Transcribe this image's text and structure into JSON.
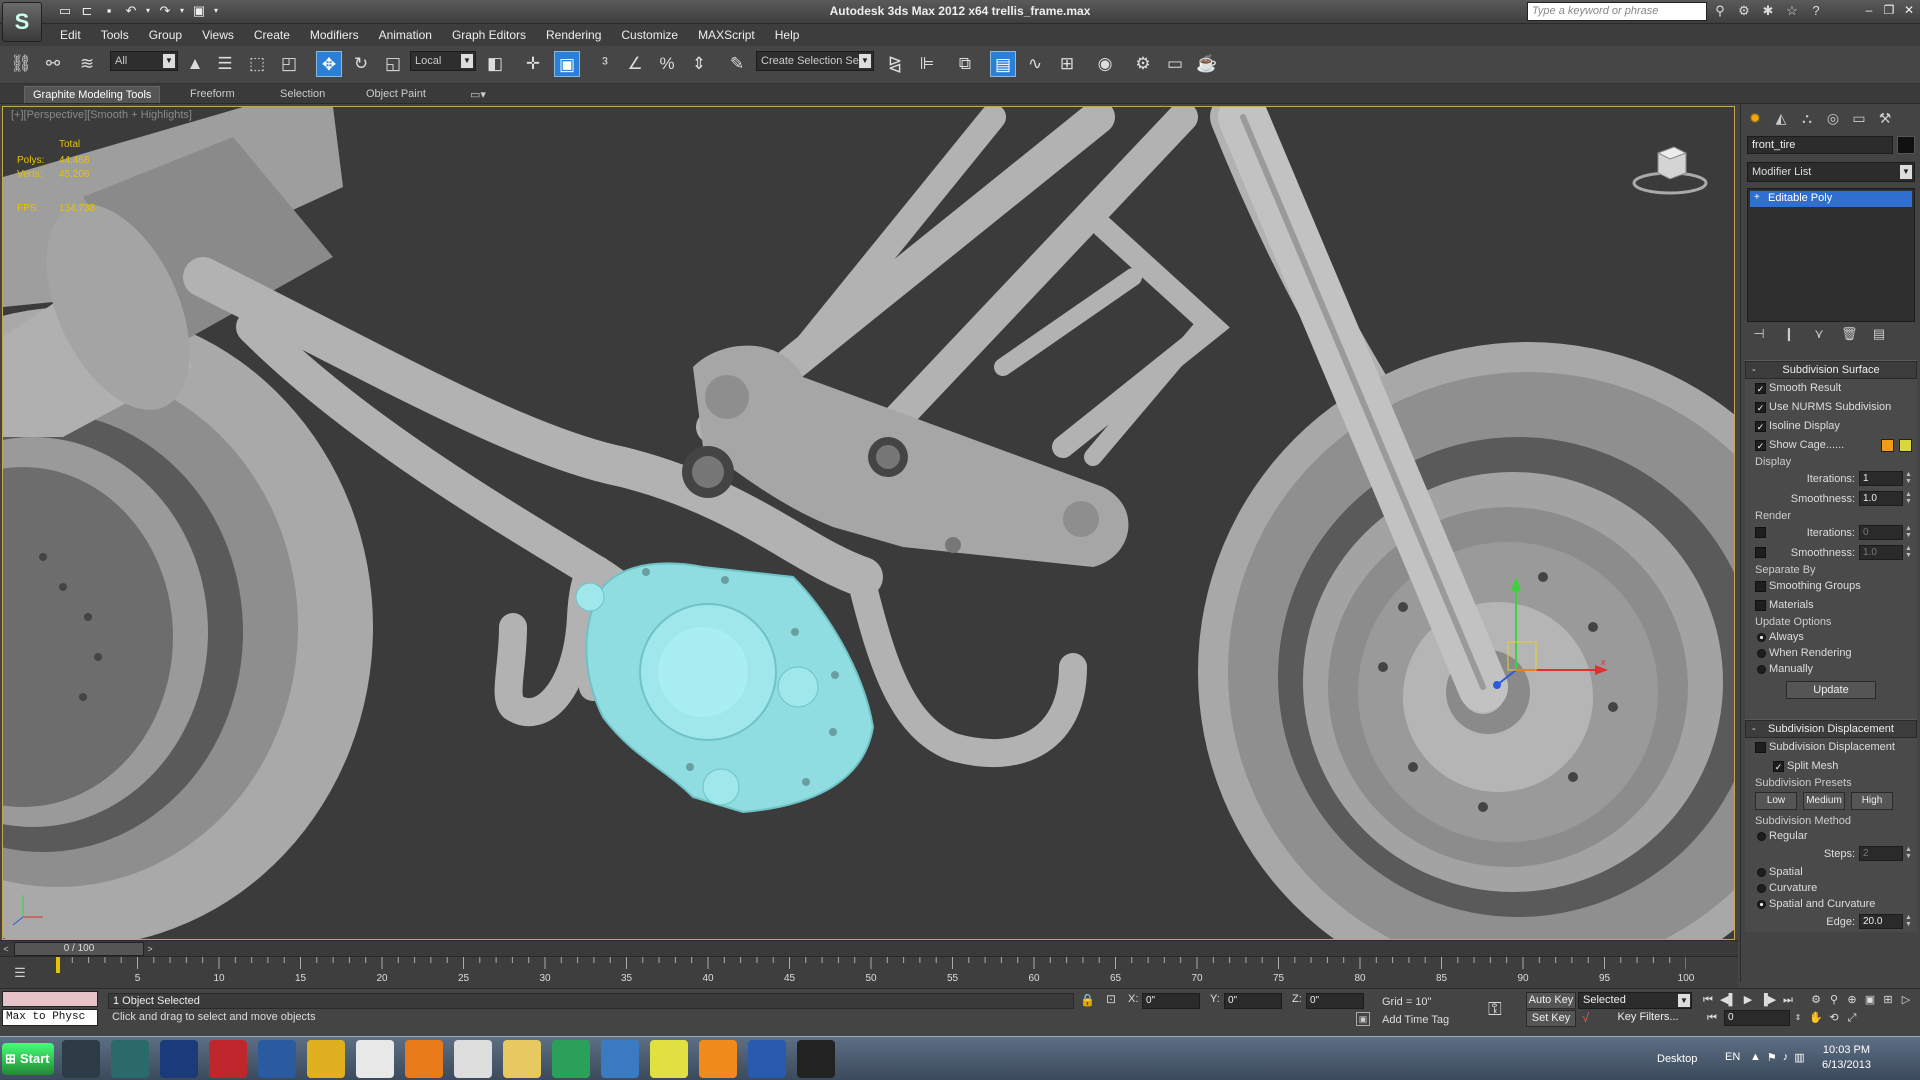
{
  "app": {
    "logo_text": "S",
    "title": "Autodesk 3ds Max  2012 x64     trellis_frame.max",
    "search_placeholder": "Type a keyword or phrase"
  },
  "menus": [
    "Edit",
    "Tools",
    "Group",
    "Views",
    "Create",
    "Modifiers",
    "Animation",
    "Graph Editors",
    "Rendering",
    "Customize",
    "MAXScript",
    "Help"
  ],
  "toolbar": {
    "selection_filter": "All",
    "ref_coord": "Local",
    "named_selection": "Create Selection Se"
  },
  "ribbon": {
    "tabs": [
      "Graphite Modeling Tools",
      "Freeform",
      "Selection",
      "Object Paint"
    ]
  },
  "viewport": {
    "label": "[+][Perspective][Smooth + Highlights]",
    "stats": {
      "total_label": "Total",
      "polys_label": "Polys:",
      "polys_value": "44,468",
      "verts_label": "Verts:",
      "verts_value": "45,206",
      "fps_label": "FPS:",
      "fps_value": "134.738"
    }
  },
  "command_panel": {
    "object_name": "front_tire",
    "modifier_list": "Modifier List",
    "stack": [
      "Editable Poly"
    ],
    "subdivision_surface": {
      "title": "Subdivision Surface",
      "smooth_result": "Smooth Result",
      "use_nurms": "Use NURMS Subdivision",
      "isoline": "Isoline Display",
      "show_cage": "Show Cage......",
      "display_label": "Display",
      "render_label": "Render",
      "iterations_label": "Iterations:",
      "smoothness_label": "Smoothness:",
      "display_iterations": "1",
      "display_smoothness": "1.0",
      "render_iterations": "0",
      "render_smoothness": "1.0",
      "separate_by": "Separate By",
      "smoothing_groups": "Smoothing Groups",
      "materials": "Materials",
      "update_options": "Update Options",
      "always": "Always",
      "when_rendering": "When Rendering",
      "manually": "Manually",
      "update_button": "Update",
      "cage_color_1": "#f29a1a",
      "cage_color_2": "#d8d83a"
    },
    "subdivision_displacement": {
      "title": "Subdivision Displacement",
      "checkbox": "Subdivision Displacement",
      "split_mesh": "Split Mesh",
      "presets_label": "Subdivision Presets",
      "low": "Low",
      "medium": "Medium",
      "high": "High",
      "method_label": "Subdivision Method",
      "regular": "Regular",
      "steps_label": "Steps:",
      "steps_value": "2",
      "spatial": "Spatial",
      "curvature": "Curvature",
      "spatial_curvature": "Spatial and Curvature",
      "edge_label": "Edge:",
      "edge_value": "20.0"
    }
  },
  "timeline": {
    "slider_text": "0 / 100",
    "ticks": [
      "5",
      "10",
      "15",
      "20",
      "25",
      "30",
      "35",
      "40",
      "45",
      "50",
      "55",
      "60",
      "65",
      "70",
      "75",
      "80",
      "85",
      "90",
      "95",
      "100"
    ]
  },
  "status": {
    "maxscript_output": "Max to Physc",
    "selection": "1 Object Selected",
    "prompt": "Click and drag to select and move objects",
    "x_label": "X:",
    "x_value": "0\"",
    "y_label": "Y:",
    "y_value": "0\"",
    "z_label": "Z:",
    "z_value": "0\"",
    "grid": "Grid = 10\"",
    "add_time_tag": "Add Time Tag",
    "auto_key": "Auto Key",
    "set_key": "Set Key",
    "key_mode": "Selected",
    "key_filters": "Key Filters...",
    "current_frame": "0"
  },
  "taskbar": {
    "start": "Start",
    "desktop": "Desktop",
    "language": "EN",
    "time": "10:03 PM",
    "date": "6/13/2013",
    "apps": [
      "3ds",
      "3ds",
      "Ps",
      "PDF",
      "Note",
      "D-Link",
      "Chrome",
      "VLC",
      "Alien",
      "Folder",
      "uTorrent",
      "Bird",
      "Picasa",
      "Media",
      "Earth",
      "Audio"
    ]
  }
}
